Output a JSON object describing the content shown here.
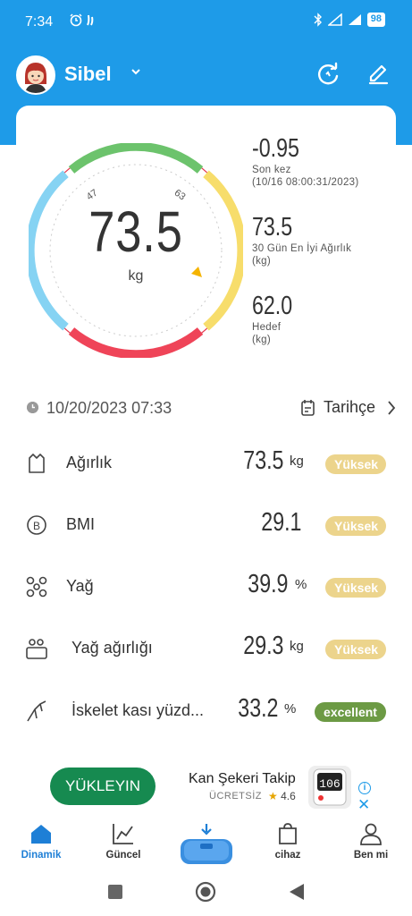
{
  "status_bar": {
    "time": "7:34",
    "battery": "98"
  },
  "header": {
    "username": "Sibel"
  },
  "gauge": {
    "value": "73.5",
    "unit": "kg",
    "tick_low": "47",
    "tick_high": "63"
  },
  "stats": [
    {
      "value": "-0.95",
      "label_1": "Son kez",
      "label_2": "(10/16 08:00:31/2023)"
    },
    {
      "value": "73.5",
      "label_1": "30 Gün En İyi Ağırlık",
      "label_2": "(kg)"
    },
    {
      "value": "62.0",
      "label_1": "Hedef",
      "label_2": "(kg)"
    }
  ],
  "measurement": {
    "datetime": "10/20/2023 07:33",
    "history_label": "Tarihçe"
  },
  "metrics": [
    {
      "icon": "weight-icon",
      "label": "Ağırlık",
      "value": "73.5",
      "unit": "kg",
      "status": "Yüksek",
      "status_color": "#ecd48c"
    },
    {
      "icon": "bmi-icon",
      "label": "BMI",
      "value": "29.1",
      "unit": "",
      "status": "Yüksek",
      "status_color": "#ecd48c"
    },
    {
      "icon": "fat-icon",
      "label": "Yağ",
      "value": "39.9",
      "unit": "%",
      "status": "Yüksek",
      "status_color": "#ecd48c"
    },
    {
      "icon": "fat-weight-icon",
      "label": "Yağ ağırlığı",
      "value": "29.3",
      "unit": "kg",
      "status": "Yüksek",
      "status_color": "#ecd48c"
    },
    {
      "icon": "skeletal-muscle-icon",
      "label": "İskelet kası yüzd...",
      "value": "33.2",
      "unit": "%",
      "status": "excellent",
      "status_color": "#6c9a44"
    }
  ],
  "ad": {
    "install_label": "YÜKLEYIN",
    "title": "Kan Şekeri Takip",
    "subtitle": "ÜCRETSİZ",
    "rating": "4.6",
    "image_text": "106"
  },
  "tabs": [
    {
      "label": "Dinamik",
      "active": true
    },
    {
      "label": "Güncel",
      "active": false
    },
    {
      "label": "cihaz",
      "active": false
    },
    {
      "label": "Ben mi",
      "active": false
    }
  ],
  "colors": {
    "accent": "#1e9be8",
    "status_high": "#ecd48c",
    "status_excellent": "#6c9a44",
    "install_button": "#168a50"
  }
}
